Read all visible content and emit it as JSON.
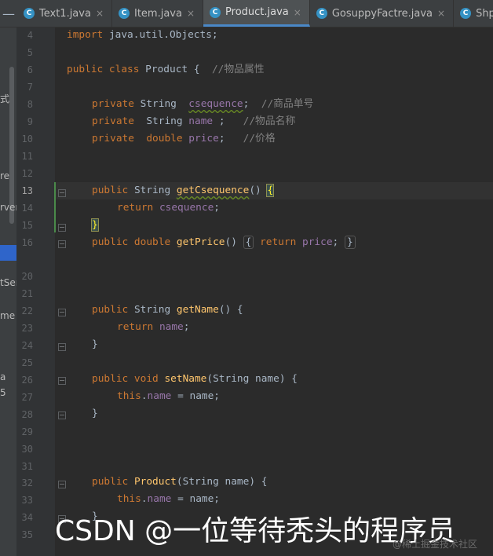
{
  "tabs": [
    {
      "label": "Text1.java",
      "close": "×"
    },
    {
      "label": "Item.java",
      "close": "×"
    },
    {
      "label": "Product.java",
      "close": "×",
      "active": true
    },
    {
      "label": "GosuppyFactre.java",
      "close": "×"
    },
    {
      "label": "ShppingDao.ja",
      "close": ""
    }
  ],
  "tab_icon_letter": "C",
  "left_panel_fragments": [
    "式",
    "re",
    "rver",
    "tSer",
    "me",
    "a",
    "5"
  ],
  "line_numbers": [
    "4",
    "5",
    "6",
    "7",
    "8",
    "9",
    "10",
    "11",
    "12",
    "13",
    "14",
    "15",
    "16",
    "20",
    "21",
    "22",
    "23",
    "24",
    "25",
    "26",
    "27",
    "28",
    "29",
    "30",
    "31",
    "32",
    "33",
    "34",
    "35"
  ],
  "code": {
    "l4": {
      "kw": "import ",
      "rest": "java.util.Objects;"
    },
    "l6": {
      "kw": "public class ",
      "name": "Product",
      "rest": " {  ",
      "cm": "//物品属性"
    },
    "l8": {
      "kw": "private ",
      "type": "String  ",
      "field": "csequence",
      "rest": ";  ",
      "cm": "//商品单号"
    },
    "l9": {
      "kw": "private  ",
      "type": "String ",
      "field": "name",
      "rest": " ;   ",
      "cm": "//物品名称"
    },
    "l10": {
      "kw": "private  double ",
      "field": "price",
      "rest": ";   ",
      "cm": "//价格"
    },
    "l13": {
      "kw": "public ",
      "type": "String ",
      "fn": "getCsequence",
      "rest": "() ",
      "brace": "{"
    },
    "l14": {
      "kw": "return ",
      "field": "csequence",
      "rest": ";"
    },
    "l15": {
      "brace": "}"
    },
    "l16": {
      "kw": "public double ",
      "fn": "getPrice",
      "rest": "() ",
      "open": "{",
      "kw2": " return ",
      "field": "price",
      "semi": ";",
      "close": "}"
    },
    "l22": {
      "kw": "public ",
      "type": "String ",
      "fn": "getName",
      "rest": "() {"
    },
    "l23": {
      "kw": "return ",
      "field": "name",
      "rest": ";"
    },
    "l24": {
      "rest": "}"
    },
    "l26": {
      "kw": "public void ",
      "fn": "setName",
      "rest": "(String name) {"
    },
    "l27": {
      "kw": "this",
      "dot": ".",
      "field": "name",
      "rest": " = name;"
    },
    "l28": {
      "rest": "}"
    },
    "l32": {
      "kw": "public ",
      "fn": "Product",
      "rest": "(String name) {"
    },
    "l33": {
      "kw": "this",
      "dot": ".",
      "field": "name",
      "rest": " = name;"
    },
    "l34": {
      "rest": "}"
    }
  },
  "watermark": "CSDN @一位等待秃头的程序员",
  "watermark_small": "@稀土掘金技术社区",
  "colors": {
    "background": "#2b2b2b",
    "keyword": "#cc7832",
    "function": "#ffc66d",
    "field": "#9876aa",
    "comment": "#808080",
    "text": "#a9b7c6"
  }
}
